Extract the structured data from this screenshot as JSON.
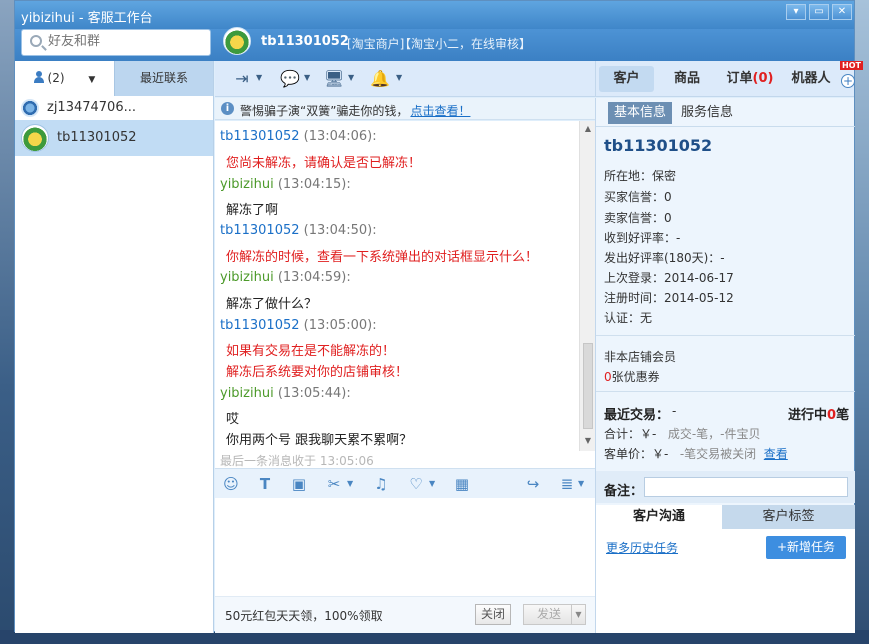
{
  "window": {
    "title": "yibizihui - 客服工作台",
    "controls": [
      "▾",
      "▭",
      "✕"
    ]
  },
  "header": {
    "search_placeholder": "好友和群",
    "contact_name": "tb11301052",
    "contact_tag": "[淘宝商户]",
    "contact_status": "【淘宝小二，在线审核】"
  },
  "left_tabs": {
    "contacts_label": "(2)",
    "recent_label": "最近联系"
  },
  "contacts": [
    {
      "name": "zj13474706..."
    },
    {
      "name": "tb11301052"
    }
  ],
  "notice": {
    "text": "警惕骗子演“双簧”骗走你的钱，",
    "link": "点击查看！"
  },
  "messages": [
    {
      "sender": "tb11301052",
      "time": "(13:04:06):",
      "lines": [
        "您尚未解冻，请确认是否已解冻！"
      ]
    },
    {
      "sender": "yibizihui",
      "time": "(13:04:15):",
      "lines": [
        "解冻了啊"
      ]
    },
    {
      "sender": "tb11301052",
      "time": "(13:04:50):",
      "lines": [
        "你解冻的时候，查看一下系统弹出的对话框显示什么！"
      ]
    },
    {
      "sender": "yibizihui",
      "time": "(13:04:59):",
      "lines": [
        "解冻了做什么？"
      ]
    },
    {
      "sender": "tb11301052",
      "time": "(13:05:00):",
      "lines": [
        "如果有交易在是不能解冻的！",
        "解冻后系统要对你的店铺审核！"
      ]
    },
    {
      "sender": "yibizihui",
      "time": "(13:05:44):",
      "lines": [
        "哎",
        "你用两个号 跟我聊天累不累啊？"
      ]
    }
  ],
  "last_message": "最后一条消息收于 13:05:06",
  "footer": {
    "promo": "50元红包天天领，100%领取",
    "close_label": "关闭",
    "send_label": "发送"
  },
  "right_tabs": {
    "customer": "客户",
    "product": "商品",
    "order": "订单",
    "order_count": "(0)",
    "robot": "机器人",
    "hot": "HOT",
    "plus": "+"
  },
  "info_tabs": {
    "basic": "基本信息",
    "service": "服务信息"
  },
  "customer": {
    "name": "tb11301052",
    "fields": [
      {
        "label": "所在地：",
        "value": "保密"
      },
      {
        "label": "买家信誉：",
        "value": "0"
      },
      {
        "label": "卖家信誉：",
        "value": "0"
      },
      {
        "label": "收到好评率：",
        "value": "-"
      },
      {
        "label": "发出好评率(180天)：",
        "value": "-"
      },
      {
        "label": "上次登录：",
        "value": "2014-06-17"
      },
      {
        "label": "注册时间：",
        "value": "2014-05-12"
      },
      {
        "label": "认证：",
        "value": "无"
      }
    ],
    "member_status": "非本店铺会员",
    "coupon_count": "0",
    "coupon_label": "张优惠券"
  },
  "trades": {
    "title": "最近交易：",
    "dash": "-",
    "progress_label": "进行中",
    "progress_count": "0",
    "progress_unit": "笔",
    "total_label": "合计：",
    "total_value": "￥-",
    "total_detail": "成交-笔，-件宝贝",
    "unit_label": "客单价：",
    "unit_value": "￥-",
    "unit_detail": "-笔交易被关闭",
    "view_link": "查看"
  },
  "note": {
    "label": "备注："
  },
  "bottom_tabs": {
    "communication": "客户沟通",
    "tags": "客户标签"
  },
  "actions": {
    "history": "更多历史任务",
    "add_task": "+新增任务"
  }
}
